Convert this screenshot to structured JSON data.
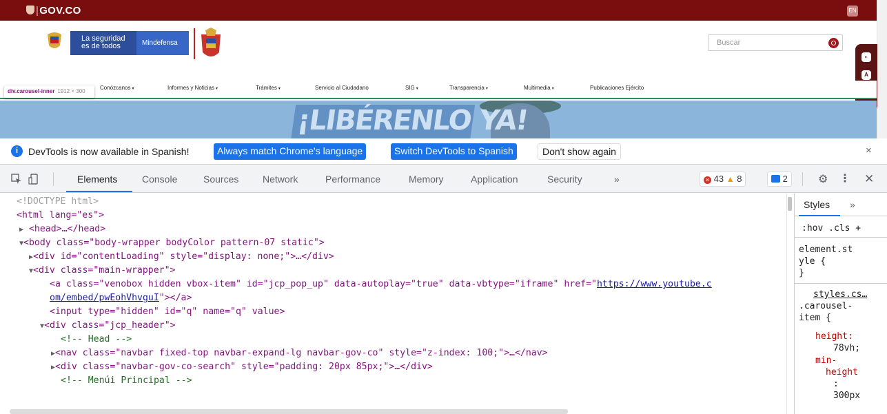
{
  "site": {
    "gov_logo": "GOV.CO",
    "lang_button": "EN",
    "header": {
      "slogan_line1": "La seguridad",
      "slogan_line2": "es de todos",
      "ministry": "Mindefensa"
    },
    "search_placeholder": "Buscar",
    "accessibility_buttons": [
      "◐",
      "A",
      "A"
    ],
    "nav": [
      {
        "label": "Conózcanos",
        "caret": true
      },
      {
        "label": "Informes y Noticias",
        "caret": true
      },
      {
        "label": "Trámites",
        "caret": true
      },
      {
        "label": "Servicio al Ciudadano",
        "caret": false
      },
      {
        "label": "SIG",
        "caret": true
      },
      {
        "label": "Transparencia",
        "caret": true
      },
      {
        "label": "Multimedia",
        "caret": true
      },
      {
        "label": "Publicaciones Ejército",
        "caret": false
      }
    ],
    "inspect_tooltip": {
      "selector": "div.carousel-inner",
      "size": "1912 × 300"
    },
    "banner_text": "¡LIBÉRENLO YA!"
  },
  "devtools": {
    "infobar": {
      "message": "DevTools is now available in Spanish!",
      "btn_match": "Always match Chrome's language",
      "btn_switch": "Switch DevTools to Spanish",
      "btn_dismiss": "Don't show again",
      "close": "×"
    },
    "tabs": [
      "Elements",
      "Console",
      "Sources",
      "Network",
      "Performance",
      "Memory",
      "Application",
      "Security"
    ],
    "more_tabs": "»",
    "errors": "43",
    "warnings": "8",
    "messages": "2",
    "elements": {
      "doctype": "<!DOCTYPE html>",
      "html_open": "<html lang=\"es\">",
      "head": "<head>…</head>",
      "body_open": "<body class=\"body-wrapper bodyColor pattern-07 static\">",
      "content_loading": "<div id=\"contentLoading\" style=\"display: none;\">…</div>",
      "main_wrapper": "<div class=\"main-wrapper\">",
      "a_line1_pre": "<a class=\"venobox hidden vbox-item\" id=\"jcp_pop_up\" data-autoplay=\"true\" data-vbtype=\"iframe\" href=\"",
      "a_link1": "https://www.youtube.c",
      "a_link2": "om/embed/pwEohVhvguI",
      "a_line2_post": "\"></a>",
      "input_hidden": "<input type=\"hidden\" id=\"q\" name=\"q\" value>",
      "jcp_header": "<div class=\"jcp_header\">",
      "comment_head": "<!-- Head -->",
      "nav_line": "<nav class=\"navbar fixed-top navbar-expand-lg navbar-gov-co\" style=\"z-index: 100;\">…</nav>",
      "search_div": "<div class=\"navbar-gov-co-search\" style=\"padding: 20px 85px;\">…</div>",
      "comment_menu": "<!-- Menúi Principal -->"
    },
    "styles": {
      "tab": "Styles",
      "more": "»",
      "filter": ":hov .cls",
      "filter_add": "+",
      "element_style_1": "element.st",
      "element_style_2": "yle {",
      "close_brace": "}",
      "source": "styles.cs…",
      "selector_1": ".carousel-",
      "selector_2": "item {",
      "prop_height": "height:",
      "val_height": "78vh;",
      "prop_min_1": "min-",
      "prop_min_2": "height",
      "prop_min_3": ":",
      "val_min": "300px"
    }
  }
}
